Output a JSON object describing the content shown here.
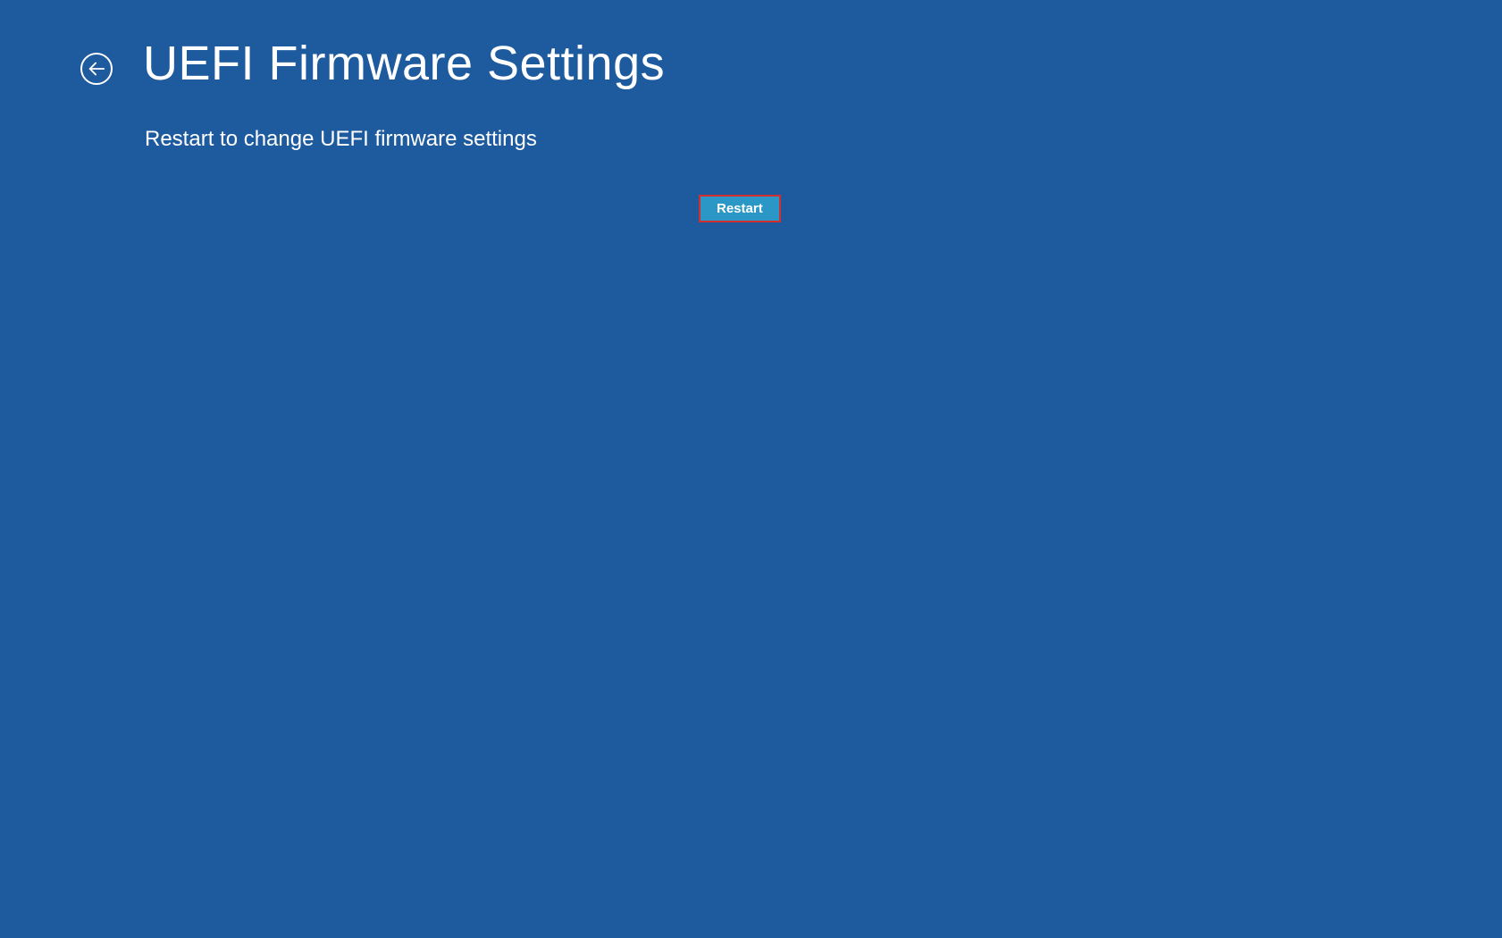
{
  "header": {
    "title": "UEFI Firmware Settings"
  },
  "body": {
    "description": "Restart to change UEFI firmware settings"
  },
  "actions": {
    "restart_label": "Restart"
  }
}
